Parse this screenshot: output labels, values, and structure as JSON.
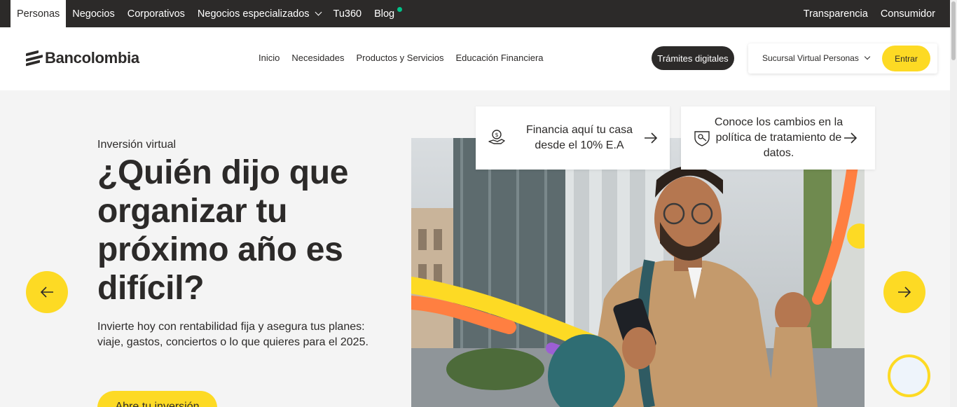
{
  "topbar": {
    "segments": [
      "Personas",
      "Negocios",
      "Corporativos",
      "Negocios especializados",
      "Tu360",
      "Blog"
    ],
    "right_links": [
      "Transparencia",
      "Consumidor"
    ],
    "blog_dot_color": "#00c389",
    "background": "#2c2a29"
  },
  "header": {
    "logo_text": "Bancolombia",
    "nav": [
      "Inicio",
      "Necesidades",
      "Productos y Servicios",
      "Educación Financiera"
    ],
    "tramites_label": "Trámites digitales",
    "sucursal_label": "Sucursal Virtual Personas",
    "entrar_label": "Entrar"
  },
  "cards": [
    {
      "text": "Financia aquí tu casa desde el 10% E.A",
      "icon": "hand-money-icon"
    },
    {
      "text": "Conoce los cambios en la política de tratamiento de datos.",
      "icon": "shield-hand-icon"
    }
  ],
  "hero": {
    "eyebrow": "Inversión virtual",
    "headline": "¿Quién dijo que organizar tu próximo año es difícil?",
    "description": "Invierte hoy con rentabilidad fija y asegura tus planes: viaje, gastos, conciertos o lo que quieres para el 2025.",
    "cta_label": "Abre tu inversión"
  },
  "colors": {
    "brand_yellow": "#fdda24",
    "brand_dark": "#2c2a29",
    "accent_orange": "#ff7f41",
    "accent_purple": "#9c5fd4"
  }
}
